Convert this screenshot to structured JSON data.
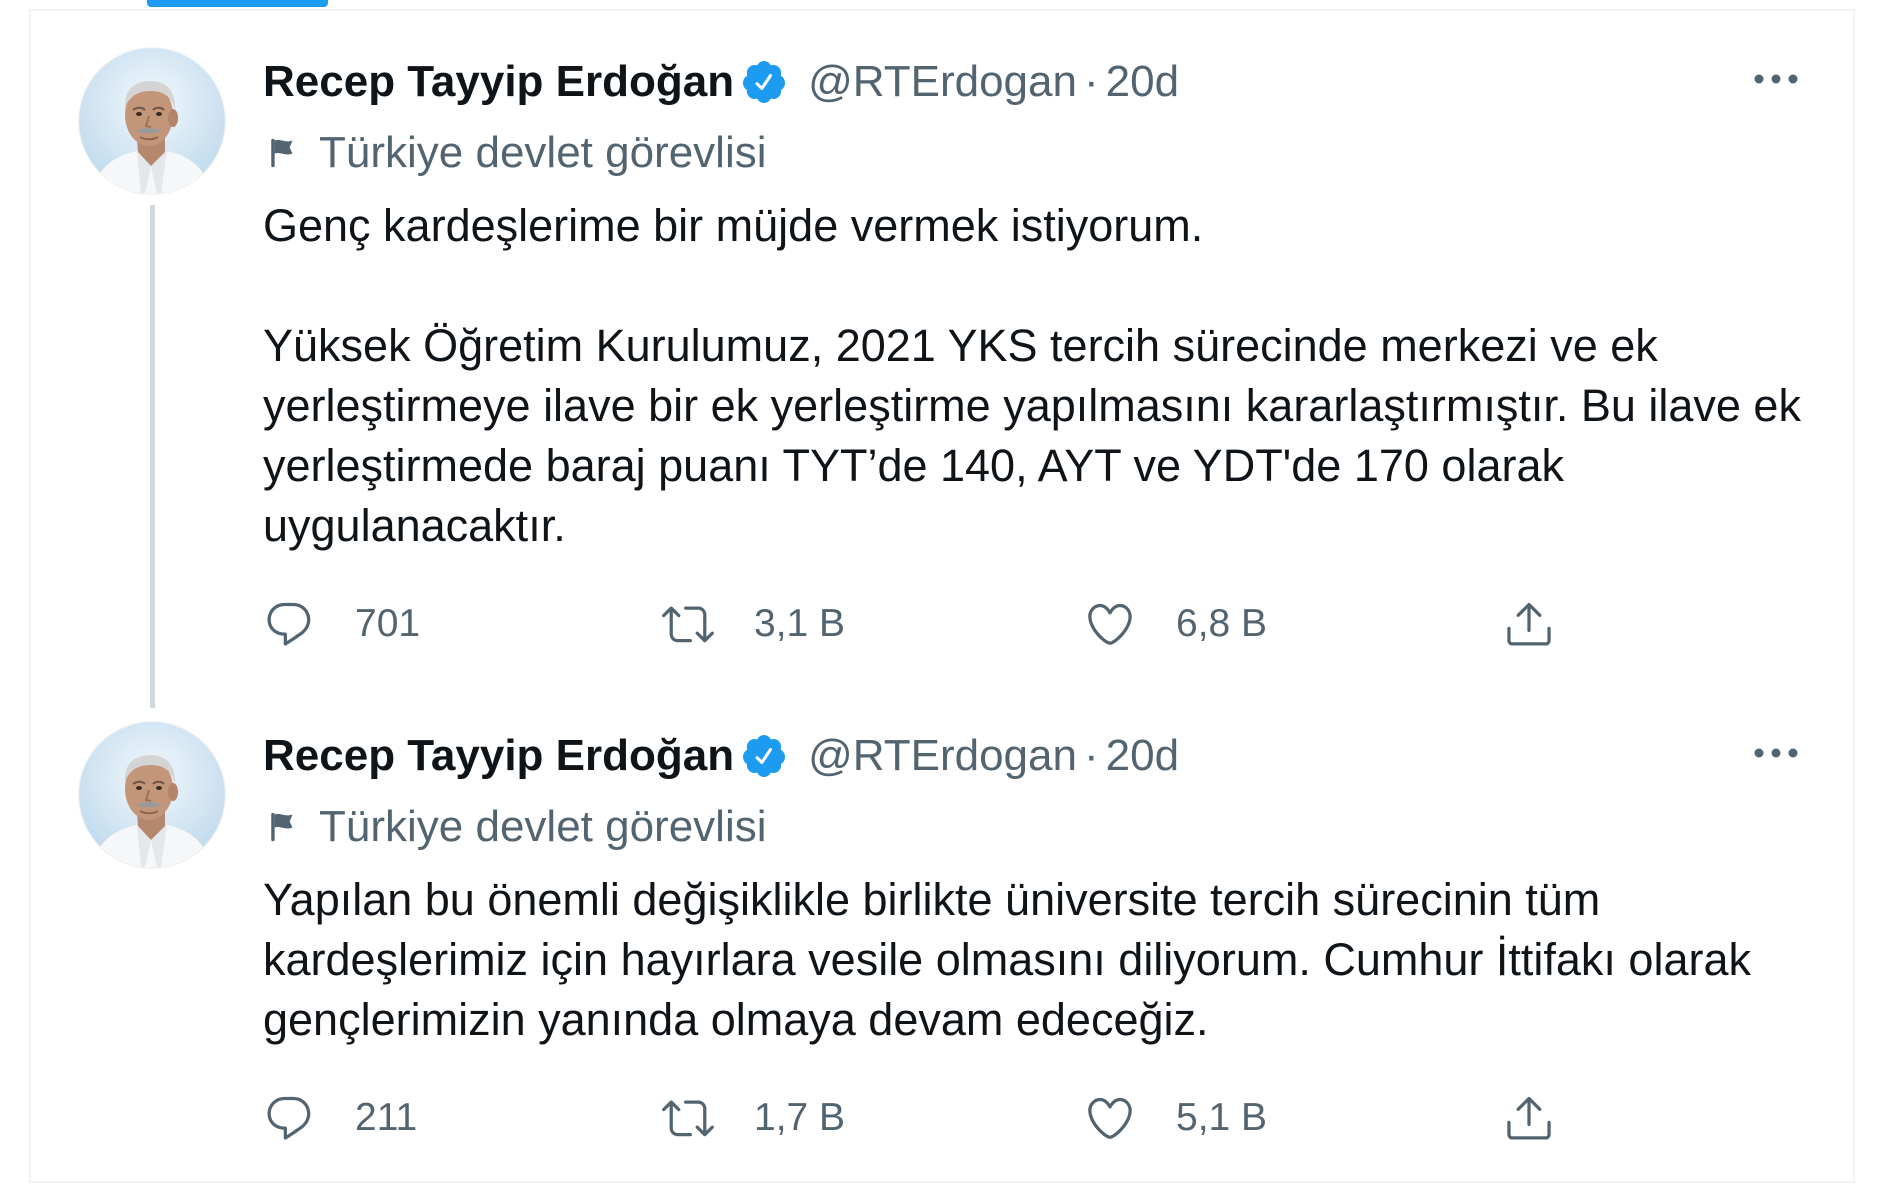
{
  "theme": {
    "accent": "#1d9bf0",
    "text_primary": "#0f1419",
    "text_secondary": "#536471",
    "border": "#eff3f4",
    "thread_line": "#cfd9de"
  },
  "tweets": [
    {
      "author": {
        "name": "Recep Tayyip Erdoğan",
        "handle": "@RTErdogan",
        "verified": true,
        "avatar_icon": "profile-photo"
      },
      "separator": "·",
      "time": "20d",
      "label": {
        "icon": "flag-icon",
        "text": "Türkiye devlet görevlisi"
      },
      "menu_icon": "more-icon",
      "paragraphs": [
        {
          "lines": [
            "Genç kardeşlerime bir müjde vermek istiyorum."
          ]
        },
        {
          "lines": [
            "Yüksek Öğretim Kurulumuz, 2021 YKS tercih sürecinde merkezi ve ek",
            "yerleştirmeye ilave bir ek yerleştirme yapılmasını kararlaştırmıştır. Bu ilave ek",
            "yerleştirmede baraj puanı TYT’de 140, AYT ve YDT'de 170 olarak",
            "uygulanacaktır."
          ]
        }
      ],
      "actions": {
        "reply": {
          "icon": "reply-icon",
          "count": "701"
        },
        "retweet": {
          "icon": "retweet-icon",
          "count": "3,1 B"
        },
        "like": {
          "icon": "heart-icon",
          "count": "6,8 B"
        },
        "share": {
          "icon": "share-icon"
        }
      },
      "thread_continues": true
    },
    {
      "author": {
        "name": "Recep Tayyip Erdoğan",
        "handle": "@RTErdogan",
        "verified": true,
        "avatar_icon": "profile-photo"
      },
      "separator": "·",
      "time": "20d",
      "label": {
        "icon": "flag-icon",
        "text": "Türkiye devlet görevlisi"
      },
      "menu_icon": "more-icon",
      "paragraphs": [
        {
          "lines": [
            "Yapılan bu önemli değişiklikle birlikte üniversite tercih sürecinin tüm",
            "kardeşlerimiz için hayırlara vesile olmasını diliyorum. Cumhur İttifakı olarak",
            "gençlerimizin yanında olmaya devam edeceğiz."
          ]
        }
      ],
      "actions": {
        "reply": {
          "icon": "reply-icon",
          "count": "211"
        },
        "retweet": {
          "icon": "retweet-icon",
          "count": "1,7 B"
        },
        "like": {
          "icon": "heart-icon",
          "count": "5,1 B"
        },
        "share": {
          "icon": "share-icon"
        }
      },
      "thread_continues": false
    }
  ]
}
